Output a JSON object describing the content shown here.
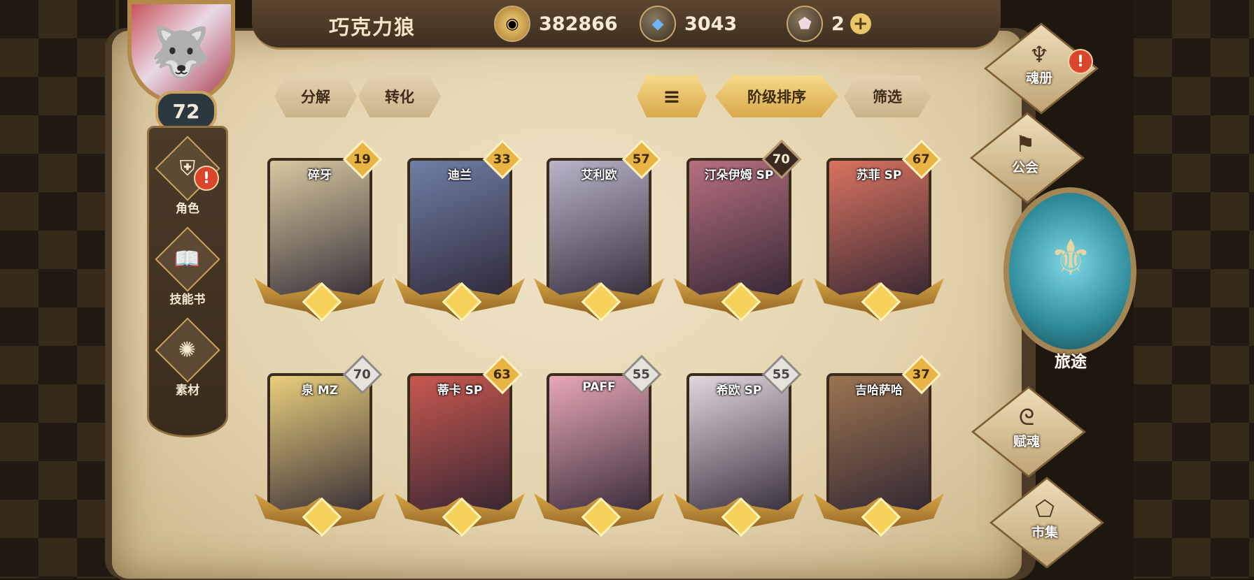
{
  "player": {
    "name": "巧克力狼",
    "level": "72"
  },
  "resources": {
    "gold": "382866",
    "crystal": "3043",
    "gem": "2"
  },
  "left_menu": [
    {
      "label": "角色",
      "icon": "helmet-icon",
      "alert": "!"
    },
    {
      "label": "技能书",
      "icon": "book-icon"
    },
    {
      "label": "素材",
      "icon": "creature-icon"
    }
  ],
  "toolbar": {
    "decompose": "分解",
    "convert": "转化",
    "sort_order_icon": "sort-lines-icon",
    "sort_by_rank": "阶级排序",
    "filter": "筛选"
  },
  "cards": [
    {
      "name": "碎牙",
      "level": "19",
      "badge": "gold",
      "color": "#d8c9a0"
    },
    {
      "name": "迪兰",
      "level": "33",
      "badge": "gold",
      "color": "#6f7fa6"
    },
    {
      "name": "艾利欧",
      "level": "57",
      "badge": "gold",
      "color": "#b9b4c8"
    },
    {
      "name": "汀朵伊姆 SP",
      "level": "70",
      "badge": "dark",
      "color": "#b76f7f"
    },
    {
      "name": "苏菲 SP",
      "level": "67",
      "badge": "gold",
      "color": "#d9735f"
    },
    {
      "name": "泉 MZ",
      "level": "70",
      "badge": "silver",
      "color": "#e9cf7d"
    },
    {
      "name": "蒂卡 SP",
      "level": "63",
      "badge": "gold",
      "color": "#c8584f"
    },
    {
      "name": "PAFF",
      "level": "55",
      "badge": "silver",
      "color": "#e8a7b6"
    },
    {
      "name": "希欧 SP",
      "level": "55",
      "badge": "silver",
      "color": "#e3d7de"
    },
    {
      "name": "吉哈萨哈",
      "level": "37",
      "badge": "gold",
      "color": "#9c7450"
    }
  ],
  "right_nav": {
    "soulbook": {
      "label": "魂册",
      "icon": "horned-helmet-icon",
      "alert": "!"
    },
    "guild": {
      "label": "公会",
      "icon": "banner-icon"
    },
    "journey": {
      "label": "旅途"
    },
    "endow": {
      "label": "赋魂",
      "icon": "swirl-icon"
    },
    "market": {
      "label": "市集",
      "icon": "crystal-icon"
    }
  }
}
